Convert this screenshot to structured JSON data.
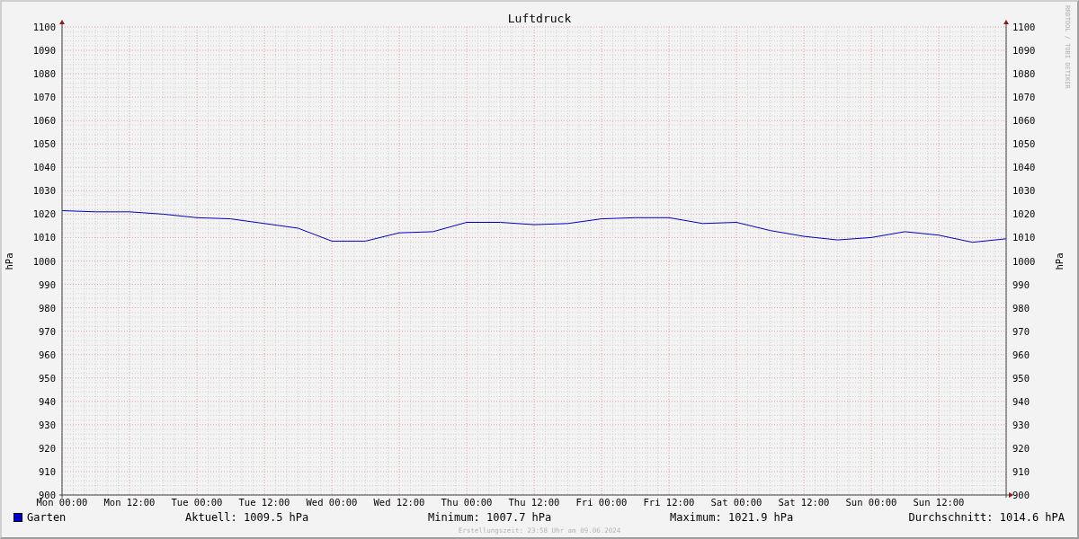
{
  "chart": {
    "watermark": "RRDTOOL / TOBI OETIKER",
    "right_axis": {
      "label": "hPa",
      "ticks": [
        "1100",
        "1090",
        "1080",
        "1070",
        "1060",
        "1050",
        "1040",
        "1030",
        "1020",
        "1010",
        "1000",
        "990",
        "980",
        "970",
        "960",
        "950",
        "940",
        "930",
        "920",
        "910",
        "900"
      ]
    },
    "chart_data": {
      "type": "line",
      "title": "Luftdruck",
      "ylabel": "hPa",
      "categories": [
        "Mon 00:00",
        null,
        "Mon 12:00",
        null,
        "Tue 00:00",
        null,
        "Tue 12:00",
        null,
        "Wed 00:00",
        null,
        "Wed 12:00",
        null,
        "Thu 00:00",
        null,
        "Thu 12:00",
        null,
        "Fri 00:00",
        null,
        "Fri 12:00",
        null,
        "Sat 00:00",
        null,
        "Sat 12:00",
        null,
        "Sun 00:00",
        null,
        "Sun 12:00",
        null,
        null
      ],
      "series": [
        {
          "name": "Garten",
          "color": "#0000cc",
          "values": [
            1021.5,
            1021,
            1021,
            1020,
            1018.5,
            1018,
            1016,
            1014,
            1008.5,
            1008.5,
            1012,
            1012.5,
            1016.5,
            1016.5,
            1015.5,
            1016,
            1018,
            1018.5,
            1018.5,
            1016,
            1016.5,
            1013,
            1010.5,
            1009,
            1010,
            1012.5,
            1011,
            1008,
            1009.5
          ]
        }
      ],
      "ylim": [
        900,
        1100
      ],
      "grid": true,
      "yticks": [
        900,
        910,
        920,
        930,
        940,
        950,
        960,
        970,
        980,
        990,
        1000,
        1010,
        1020,
        1030,
        1040,
        1050,
        1060,
        1070,
        1080,
        1090,
        1100
      ]
    }
  },
  "legend": {
    "items": [
      "Aktuell: 1009.5 hPa",
      "Minimum: 1007.7 hPa",
      "Maximum: 1021.9 hPa",
      "Durchschnitt: 1014.6 hPA"
    ]
  },
  "footer": "Erstellungszeit: 23:58 Uhr am 09.06.2024"
}
